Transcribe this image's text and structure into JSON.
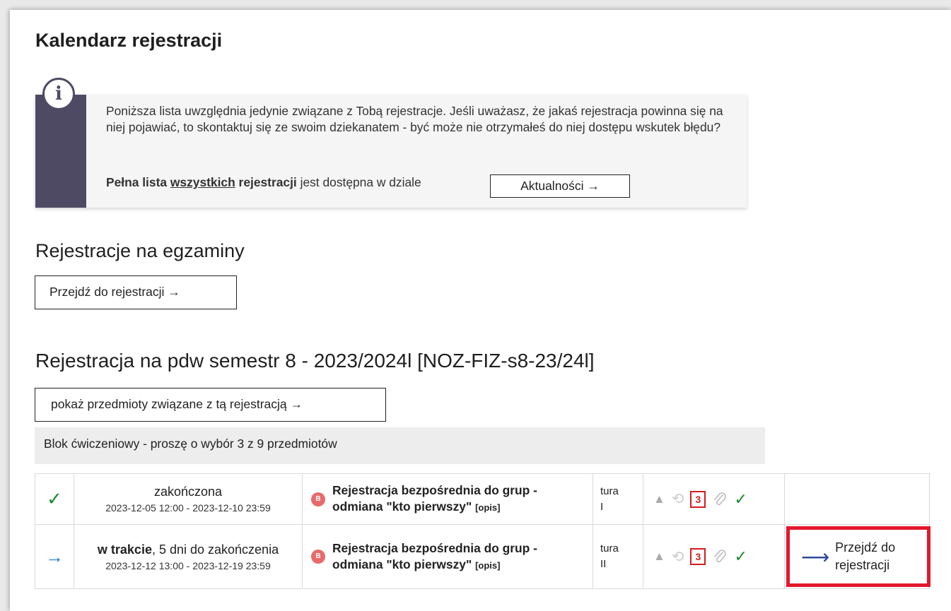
{
  "page_title": "Kalendarz rejestracji",
  "info": {
    "text": "Poniższa lista uwzględnia jedynie związane z Tobą rejestracje. Jeśli uważasz, że jakaś rejestracja powinna się na niej pojawiać, to skontaktuj się ze swoim dziekanatem - być może nie otrzymałeś do niej dostępu wskutek błędu?",
    "full_list_bold1": "Pełna lista",
    "full_list_link": "wszystkich",
    "full_list_bold2": "rejestracji",
    "full_list_rest": "jest dostępna w dziale",
    "news_button": "Aktualności →"
  },
  "exams": {
    "heading": "Rejestracje na egzaminy",
    "button": "Przejdź do rejestracji →"
  },
  "registration": {
    "heading": "Rejestracja na pdw semestr 8 - 2023/2024l [NOZ-FIZ-s8-23/24l]",
    "show_subjects_button": "pokaż przedmioty związane z tą rejestracją →",
    "block_label": "Blok ćwiczeniowy - proszę o wybór 3 z 9 przedmiotów",
    "rows": [
      {
        "status_icon": "check-icon",
        "state": "zakończona",
        "state_extra": "",
        "dates": "2023-12-05 12:00 - 2023-12-10 23:59",
        "badge": "B",
        "name_line1": "Rejestracja bezpośrednia do grup -",
        "name_line2": "odmiana \"kto pierwszy\"",
        "opis": "[opis]",
        "tura_word": "tura",
        "tura_num": "I",
        "limit": "3",
        "action": ""
      },
      {
        "status_icon": "arrow-right-icon",
        "state": "w trakcie",
        "state_extra": ", 5 dni do zakończenia",
        "dates": "2023-12-12 13:00 - 2023-12-19 23:59",
        "badge": "B",
        "name_line1": "Rejestracja bezpośrednia do grup -",
        "name_line2": "odmiana \"kto pierwszy\"",
        "opis": "[opis]",
        "tura_word": "tura",
        "tura_num": "II",
        "limit": "3",
        "action_line1": "Przejdź do",
        "action_line2": "rejestracji"
      }
    ]
  },
  "colors": {
    "info_bar": "#4f4a64",
    "check": "#1a8b2b",
    "arrow": "#1a7dd6",
    "highlight": "#e3182d"
  }
}
